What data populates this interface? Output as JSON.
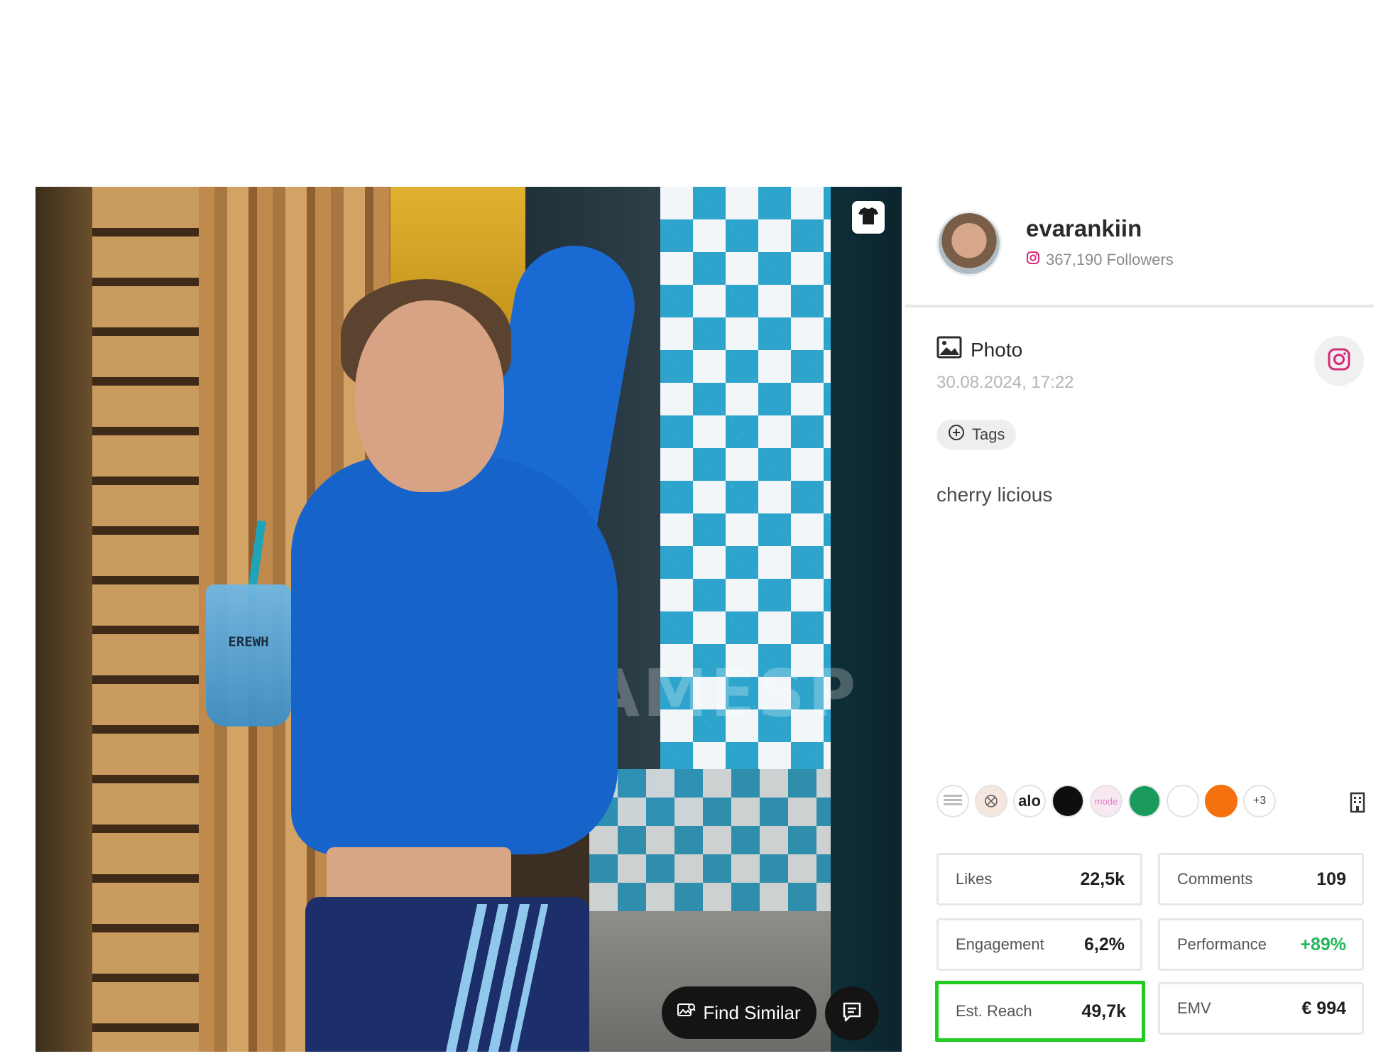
{
  "post": {
    "find_similar_label": "Find Similar",
    "cup_text": "EREWH",
    "watermark": "AMESP"
  },
  "profile": {
    "username": "evarankiin",
    "followers": "367,190 Followers"
  },
  "content": {
    "type_label": "Photo",
    "date": "30.08.2024, 17:22",
    "tags_label": "Tags",
    "caption": "cherry licious"
  },
  "brands": {
    "items": [
      "",
      "",
      "alo",
      "",
      "mode",
      "",
      "",
      ""
    ],
    "more_label": "+3"
  },
  "metrics": {
    "likes_label": "Likes",
    "likes_value": "22,5k",
    "comments_label": "Comments",
    "comments_value": "109",
    "engagement_label": "Engagement",
    "engagement_value": "6,2%",
    "performance_label": "Performance",
    "performance_value": "+89%",
    "reach_label": "Est. Reach",
    "reach_value": "49,7k",
    "emv_label": "EMV",
    "emv_value": "€ 994"
  },
  "colors": {
    "highlight": "#22cc22",
    "positive": "#1fb85b",
    "instagram": "#d62976"
  }
}
